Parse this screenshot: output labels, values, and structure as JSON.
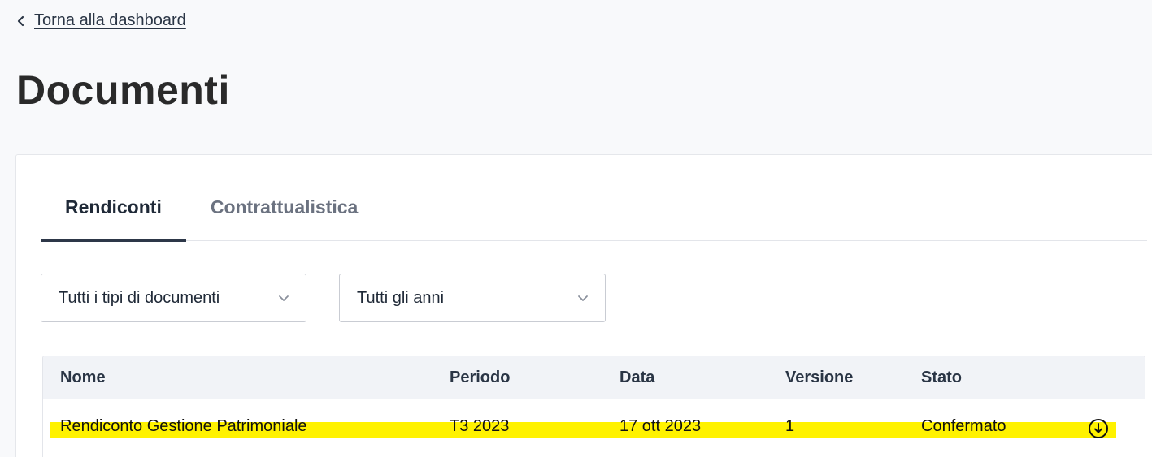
{
  "nav": {
    "back_label": "Torna alla dashboard"
  },
  "page": {
    "title": "Documenti"
  },
  "tabs": [
    {
      "label": "Rendiconti",
      "active": true
    },
    {
      "label": "Contrattualistica",
      "active": false
    }
  ],
  "filters": {
    "doc_type": {
      "value": "Tutti i tipi di documenti"
    },
    "year": {
      "value": "Tutti gli anni"
    }
  },
  "table": {
    "columns": [
      "Nome",
      "Periodo",
      "Data",
      "Versione",
      "Stato"
    ],
    "rows": [
      {
        "nome": "Rendiconto Gestione Patrimoniale",
        "periodo": "T3 2023",
        "data": "17 ott 2023",
        "versione": "1",
        "stato": "Confermato",
        "highlighted": true
      }
    ]
  },
  "colors": {
    "highlight": "#fff200",
    "active_tab_underline": "#2d3748",
    "header_bg": "#f1f3f7"
  },
  "icons": {
    "back": "chevron-left-icon",
    "select_caret": "chevron-down-icon",
    "download": "download-circle-icon"
  }
}
